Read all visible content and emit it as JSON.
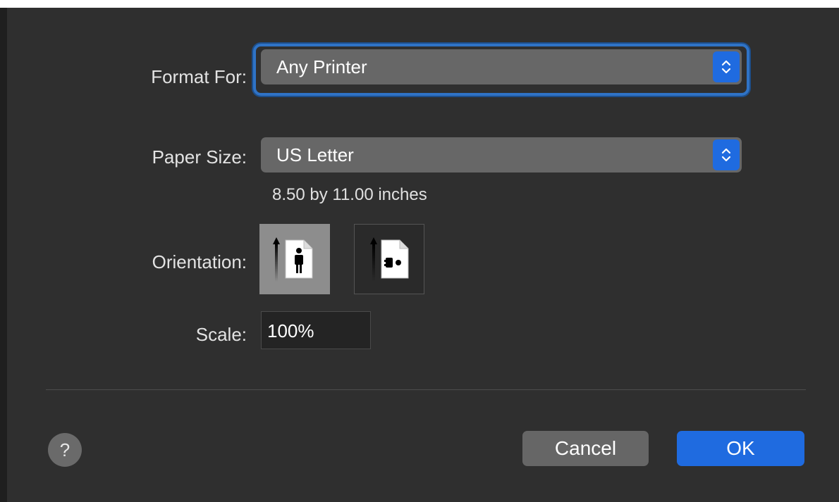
{
  "format_for": {
    "label": "Format For:",
    "value": "Any Printer"
  },
  "paper_size": {
    "label": "Paper Size:",
    "value": "US Letter",
    "dimensions": "8.50 by 11.00 inches"
  },
  "orientation": {
    "label": "Orientation:",
    "options": [
      {
        "name": "portrait",
        "selected": true
      },
      {
        "name": "landscape",
        "selected": false
      }
    ]
  },
  "scale": {
    "label": "Scale:",
    "value": "100%"
  },
  "buttons": {
    "help": "?",
    "cancel": "Cancel",
    "ok": "OK"
  },
  "colors": {
    "accent": "#1f6be0",
    "background": "#2f2f2f",
    "focus": "#2f73c6"
  }
}
